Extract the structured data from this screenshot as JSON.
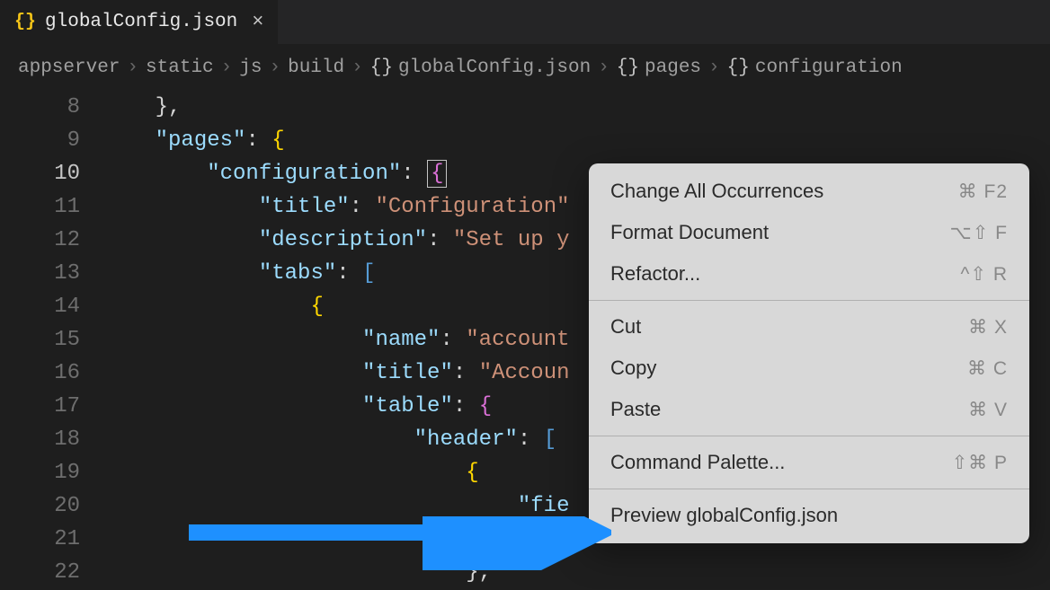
{
  "tab": {
    "icon": "{}",
    "title": "globalConfig.json"
  },
  "breadcrumb": {
    "items": [
      {
        "label": "appserver"
      },
      {
        "label": "static"
      },
      {
        "label": "js"
      },
      {
        "label": "build"
      },
      {
        "icon": "{}",
        "label": "globalConfig.json"
      },
      {
        "icon": "{}",
        "label": "pages"
      },
      {
        "icon": "{}",
        "label": "configuration"
      }
    ]
  },
  "lines": {
    "8": "},",
    "9": "\"pages\": {",
    "10": "\"configuration\": {",
    "11": "\"title\": \"Configuration\"",
    "12": "\"description\": \"Set up y",
    "13": "\"tabs\": [",
    "14": "{",
    "15": "\"name\": \"account",
    "16": "\"title\": \"Accoun",
    "17": "\"table\": {",
    "18": "\"header\": [",
    "19": "{",
    "20": "\"fie",
    "21": "},",
    "22": "},"
  },
  "gutter": [
    "8",
    "9",
    "10",
    "11",
    "12",
    "13",
    "14",
    "15",
    "16",
    "17",
    "18",
    "19",
    "20",
    "21",
    "22"
  ],
  "current_line": "10",
  "context_menu": {
    "items": [
      {
        "label": "Change All Occurrences",
        "shortcut": "⌘ F2"
      },
      {
        "label": "Format Document",
        "shortcut": "⌥⇧ F"
      },
      {
        "label": "Refactor...",
        "shortcut": "^⇧ R"
      },
      {
        "sep": true
      },
      {
        "label": "Cut",
        "shortcut": "⌘ X"
      },
      {
        "label": "Copy",
        "shortcut": "⌘ C"
      },
      {
        "label": "Paste",
        "shortcut": "⌘ V"
      },
      {
        "sep": true
      },
      {
        "label": "Command Palette...",
        "shortcut": "⇧⌘ P"
      },
      {
        "sep": true
      },
      {
        "label": "Preview globalConfig.json",
        "shortcut": ""
      }
    ]
  }
}
